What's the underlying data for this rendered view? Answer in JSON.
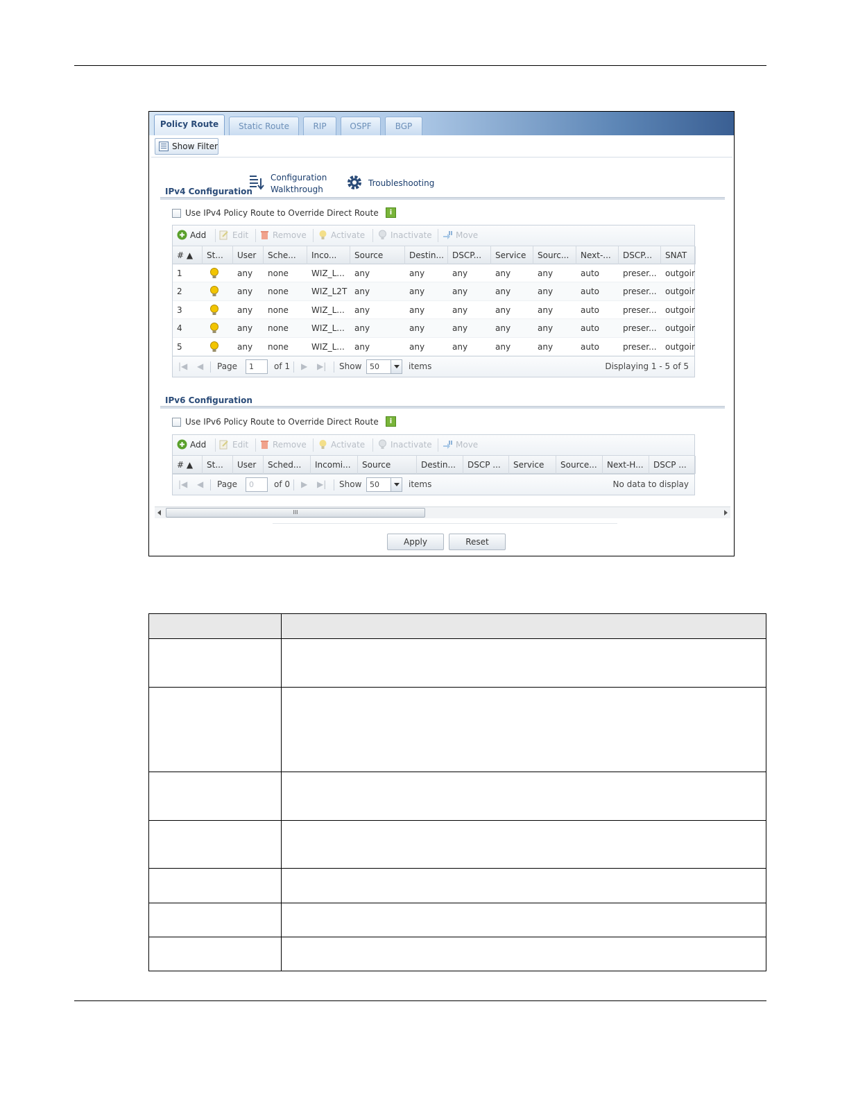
{
  "tabs": [
    "Policy Route",
    "Static Route",
    "RIP",
    "OSPF",
    "BGP"
  ],
  "show_filter": "Show Filter",
  "helpers": {
    "config_walkthrough_line1": "Configuration",
    "config_walkthrough_line2": "Walkthrough",
    "troubleshooting": "Troubleshooting"
  },
  "toolbar": {
    "add": "Add",
    "edit": "Edit",
    "remove": "Remove",
    "activate": "Activate",
    "inactivate": "Inactivate",
    "move": "Move"
  },
  "ipv4": {
    "title": "IPv4 Configuration",
    "override_label": "Use IPv4 Policy Route to Override Direct Route",
    "columns": [
      "# ▲",
      "St...",
      "User",
      "Sche...",
      "Inco...",
      "Source",
      "Destin...",
      "DSCP...",
      "Service",
      "Sourc...",
      "Next-...",
      "DSCP...",
      "SNAT"
    ],
    "rows": [
      [
        "1",
        "",
        "any",
        "none",
        "WIZ_L...",
        "any",
        "any",
        "any",
        "any",
        "any",
        "auto",
        "preser...",
        "outgoir"
      ],
      [
        "2",
        "",
        "any",
        "none",
        "WIZ_L2T",
        "any",
        "any",
        "any",
        "any",
        "any",
        "auto",
        "preser...",
        "outgoir"
      ],
      [
        "3",
        "",
        "any",
        "none",
        "WIZ_L...",
        "any",
        "any",
        "any",
        "any",
        "any",
        "auto",
        "preser...",
        "outgoir"
      ],
      [
        "4",
        "",
        "any",
        "none",
        "WIZ_L...",
        "any",
        "any",
        "any",
        "any",
        "any",
        "auto",
        "preser...",
        "outgoir"
      ],
      [
        "5",
        "",
        "any",
        "none",
        "WIZ_L...",
        "any",
        "any",
        "any",
        "any",
        "any",
        "auto",
        "preser...",
        "outgoir"
      ]
    ],
    "pager": {
      "page_label": "Page",
      "page_value": "1",
      "of_label": "of 1",
      "show_label": "Show",
      "show_value": "50",
      "items_label": "items",
      "status": "Displaying 1 - 5 of 5"
    }
  },
  "ipv6": {
    "title": "IPv6 Configuration",
    "override_label": "Use IPv6 Policy Route to Override Direct Route",
    "columns": [
      "# ▲",
      "St...",
      "User",
      "Sched...",
      "Incomi...",
      "Source",
      "Destin...",
      "DSCP ...",
      "Service",
      "Source...",
      "Next-H...",
      "DSCP ..."
    ],
    "pager": {
      "page_label": "Page",
      "page_value": "0",
      "of_label": "of 0",
      "show_label": "Show",
      "show_value": "50",
      "items_label": "items",
      "status": "No data to display"
    }
  },
  "scroll_grip": "III",
  "buttons": {
    "apply": "Apply",
    "reset": "Reset"
  },
  "colors": {
    "active_bulb": "#f2c500",
    "brand_blue": "#2a4b78",
    "info_green": "#79b43a"
  }
}
